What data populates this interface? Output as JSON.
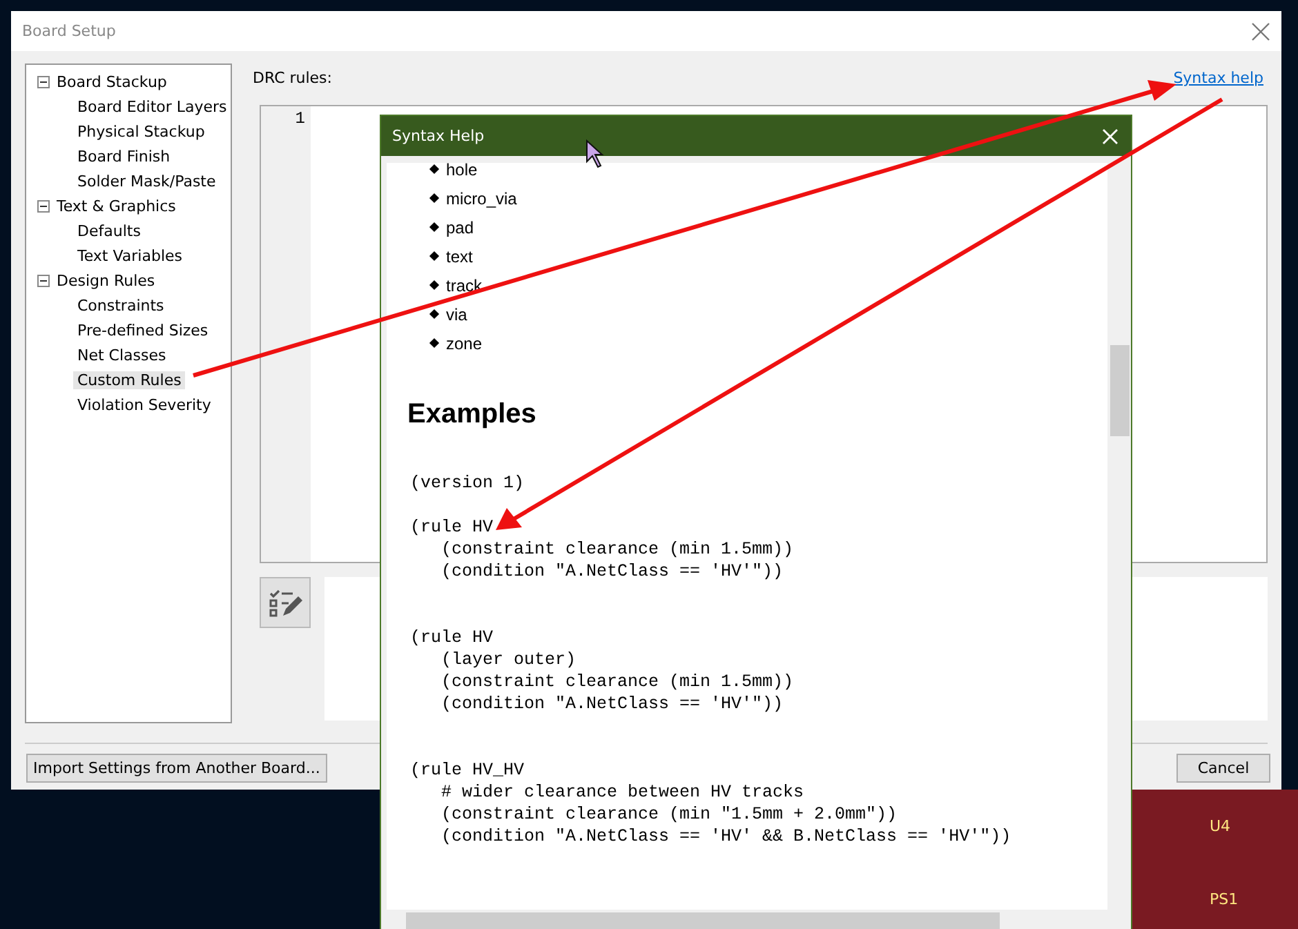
{
  "dialog": {
    "title": "Board Setup",
    "tree": [
      {
        "label": "Board Stackup",
        "expanded": true,
        "selected": false,
        "children": [
          {
            "label": "Board Editor Layers",
            "selected": false
          },
          {
            "label": "Physical Stackup",
            "selected": false
          },
          {
            "label": "Board Finish",
            "selected": false
          },
          {
            "label": "Solder Mask/Paste",
            "selected": false
          }
        ]
      },
      {
        "label": "Text & Graphics",
        "expanded": true,
        "selected": false,
        "children": [
          {
            "label": "Defaults",
            "selected": false
          },
          {
            "label": "Text Variables",
            "selected": false
          }
        ]
      },
      {
        "label": "Design Rules",
        "expanded": true,
        "selected": false,
        "children": [
          {
            "label": "Constraints",
            "selected": false
          },
          {
            "label": "Pre-defined Sizes",
            "selected": false
          },
          {
            "label": "Net Classes",
            "selected": false
          },
          {
            "label": "Custom Rules",
            "selected": true
          },
          {
            "label": "Violation Severity",
            "selected": false
          }
        ]
      }
    ],
    "drc_label": "DRC rules:",
    "help_link": "Syntax help",
    "line_numbers": [
      "1"
    ],
    "import_button": "Import Settings from Another Board...",
    "cancel_button": "Cancel"
  },
  "help_window": {
    "title": "Syntax Help",
    "list_items": [
      "hole",
      "micro_via",
      "pad",
      "text",
      "track",
      "via",
      "zone"
    ],
    "heading": "Examples",
    "code_blocks": [
      [
        "(version 1)"
      ],
      [
        "(rule HV",
        "   (constraint clearance (min 1.5mm))",
        "   (condition \"A.NetClass == 'HV'\"))"
      ],
      [
        "(rule HV",
        "   (layer outer)",
        "   (constraint clearance (min 1.5mm))",
        "   (condition \"A.NetClass == 'HV'\"))"
      ],
      [
        "(rule HV_HV",
        "   # wider clearance between HV tracks",
        "   (constraint clearance (min \"1.5mm + 2.0mm\"))",
        "   (condition \"A.NetClass == 'HV' && B.NetClass == 'HV'\"))"
      ]
    ]
  },
  "pcb": {
    "labels": [
      "U4",
      "PS1"
    ]
  }
}
